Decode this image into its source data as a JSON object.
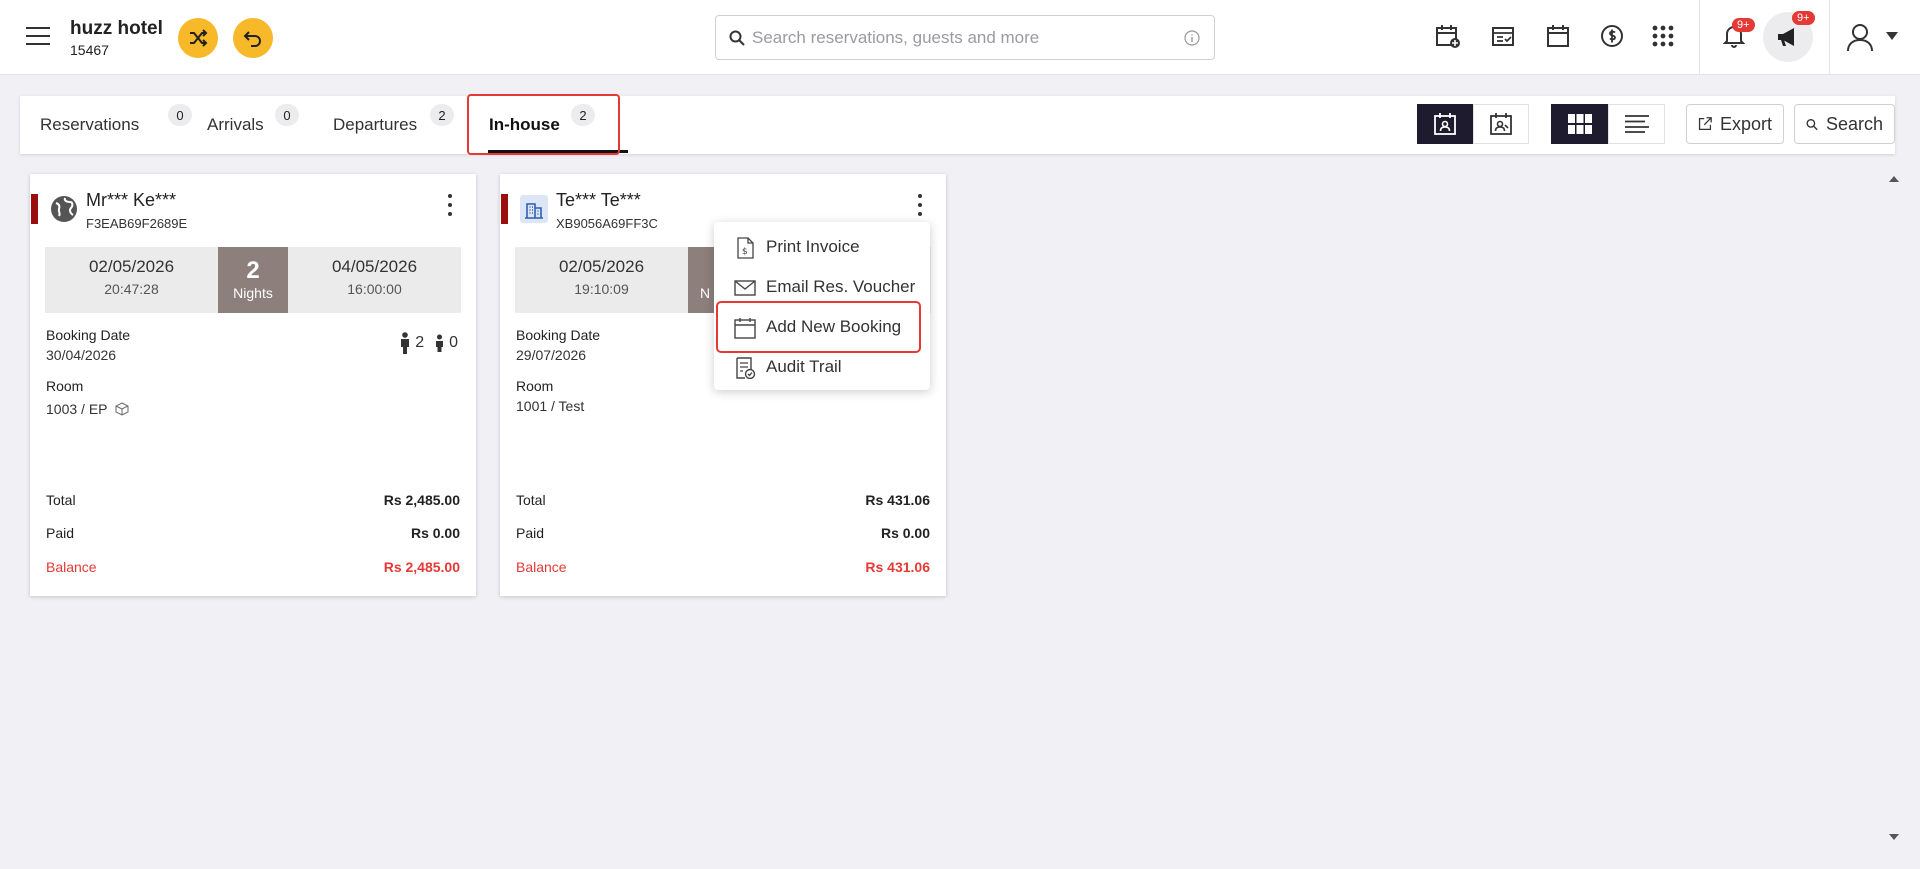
{
  "header": {
    "hotel_name": "huzz hotel",
    "hotel_id": "15467",
    "search_placeholder": "Search reservations, guests and more",
    "notifications_badge": "9+",
    "announcements_badge": "9+",
    "icons": [
      "shuffle-icon",
      "undo-icon",
      "calendar-add-icon",
      "checklist-icon",
      "calendar-icon",
      "dollar-icon",
      "apps-grid-icon",
      "bell-icon",
      "megaphone-icon",
      "user-icon",
      "caret-down-icon"
    ]
  },
  "tabs": [
    {
      "label": "Reservations",
      "count": "0"
    },
    {
      "label": "Arrivals",
      "count": "0"
    },
    {
      "label": "Departures",
      "count": "2"
    },
    {
      "label": "In-house",
      "count": "2",
      "active": true
    }
  ],
  "toolbar": {
    "export_label": "Export",
    "search_label": "Search"
  },
  "cards": [
    {
      "guest_name": "Mr*** Ke***",
      "code": "F3EAB69F2689E",
      "arrival_date": "02/05/2026",
      "arrival_time": "20:47:28",
      "nights": "2",
      "nights_label": "Nights",
      "departure_date": "04/05/2026",
      "departure_time": "16:00:00",
      "booking_date_label": "Booking Date",
      "booking_date": "30/04/2026",
      "adults": "2",
      "children": "0",
      "room_label": "Room",
      "room": "1003 / EP",
      "total_label": "Total",
      "total": "Rs 2,485.00",
      "paid_label": "Paid",
      "paid": "Rs 0.00",
      "balance_label": "Balance",
      "balance": "Rs 2,485.00"
    },
    {
      "guest_name": "Te*** Te***",
      "code": "XB9056A69FF3C",
      "arrival_date": "02/05/2026",
      "arrival_time": "19:10:09",
      "nights_label": "N",
      "booking_date_label": "Booking Date",
      "booking_date": "29/07/2026",
      "room_label": "Room",
      "room": "1001 / Test",
      "total_label": "Total",
      "total": "Rs 431.06",
      "paid_label": "Paid",
      "paid": "Rs 0.00",
      "balance_label": "Balance",
      "balance": "Rs 431.06"
    }
  ],
  "context_menu": {
    "items": [
      {
        "label": "Print Invoice",
        "icon": "invoice-icon"
      },
      {
        "label": "Email Res. Voucher",
        "icon": "mail-icon"
      },
      {
        "label": "Add New Booking",
        "icon": "calendar-icon"
      },
      {
        "label": "Audit Trail",
        "icon": "audit-icon"
      }
    ]
  },
  "colors": {
    "accent_yellow": "#f7b82a",
    "status_bar": "#9b0e0e",
    "balance_red": "#e53935",
    "nights_block": "#8c7f7c",
    "highlight_red": "#e53935"
  }
}
